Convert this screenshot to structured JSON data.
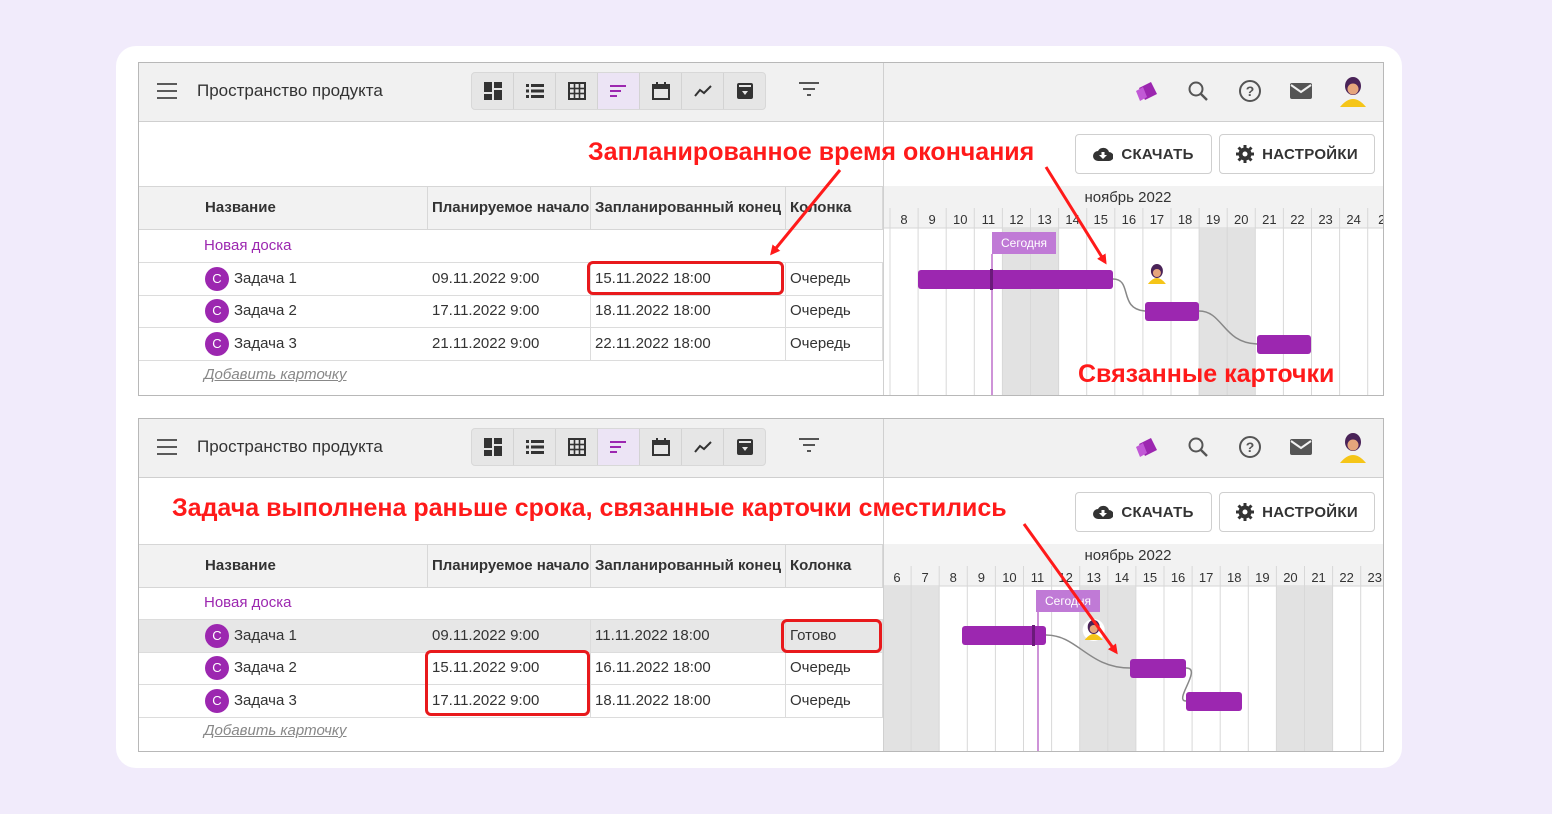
{
  "app": {
    "workspace_title": "Пространство продукта",
    "download_label": "СКАЧАТЬ",
    "settings_label": "НАСТРОЙКИ"
  },
  "columns": [
    "Название",
    "Планируемое начало",
    "Запланированный конец",
    "Колонка"
  ],
  "group_name": "Новая доска",
  "add_card_label": "Добавить карточку",
  "avatar_letter": "С",
  "month_label": "ноябрь 2022",
  "today_label": "Сегодня",
  "panel1": {
    "callout_top": "Запланированное время окончания",
    "callout_bottom": "Связанные карточки",
    "days": [
      "8",
      "9",
      "10",
      "11",
      "12",
      "13",
      "14",
      "15",
      "16",
      "17",
      "18",
      "19",
      "20",
      "21",
      "22",
      "23",
      "24",
      "2"
    ],
    "tasks": [
      {
        "name": "Задача 1",
        "start": "09.11.2022 9:00",
        "end": "15.11.2022 18:00",
        "column": "Очередь"
      },
      {
        "name": "Задача 2",
        "start": "17.11.2022 9:00",
        "end": "18.11.2022 18:00",
        "column": "Очередь"
      },
      {
        "name": "Задача 3",
        "start": "21.11.2022 9:00",
        "end": "22.11.2022 18:00",
        "column": "Очередь"
      }
    ]
  },
  "panel2": {
    "callout_top": "Задача выполнена раньше срока, связанные карточки сместились",
    "days": [
      "6",
      "7",
      "8",
      "9",
      "10",
      "11",
      "12",
      "13",
      "14",
      "15",
      "16",
      "17",
      "18",
      "19",
      "20",
      "21",
      "22",
      "23"
    ],
    "tasks": [
      {
        "name": "Задача 1",
        "start": "09.11.2022 9:00",
        "end": "11.11.2022 18:00",
        "column": "Готово"
      },
      {
        "name": "Задача 2",
        "start": "15.11.2022 9:00",
        "end": "16.11.2022 18:00",
        "column": "Очередь"
      },
      {
        "name": "Задача 3",
        "start": "17.11.2022 9:00",
        "end": "18.11.2022 18:00",
        "column": "Очередь"
      }
    ]
  },
  "colors": {
    "accent": "#9c27b0",
    "callout": "#ff1a1a",
    "today_bar": "#c07ad6",
    "weekend": "#e2e2e2"
  }
}
